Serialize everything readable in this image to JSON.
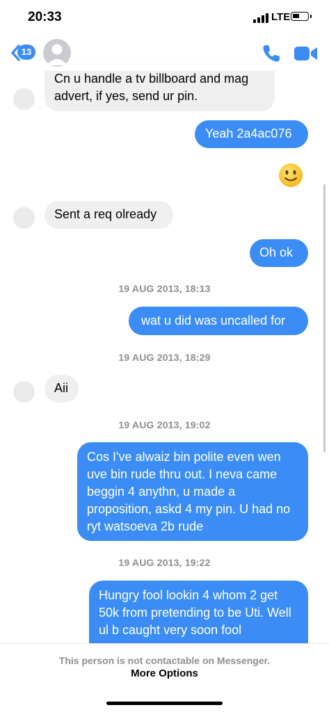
{
  "status_bar": {
    "time": "20:33",
    "carrier": "LTE"
  },
  "header": {
    "back_count": "13",
    "phone_icon": "phone-icon",
    "video_icon": "video-camera-icon"
  },
  "messages": [
    {
      "direction": "in",
      "text": "Cn u handle a tv billboard and mag advert, if yes, send ur pin."
    },
    {
      "direction": "out",
      "text": "Yeah 2a4ac076"
    },
    {
      "direction": "out",
      "emoji": "slightly-smiling-face"
    },
    {
      "direction": "in",
      "text": "Sent a req olready"
    },
    {
      "direction": "out",
      "text": "Oh ok"
    },
    {
      "timestamp": "19 AUG 2013, 18:13"
    },
    {
      "direction": "out",
      "text": "wat u did was uncalled for"
    },
    {
      "timestamp": "19 AUG 2013, 18:29"
    },
    {
      "direction": "in",
      "text": "Aii"
    },
    {
      "timestamp": "19 AUG 2013, 19:02"
    },
    {
      "direction": "out",
      "text": "Cos I've alwaiz bin polite even wen uve bin rude thru out. I neva came beggin 4 anythn, u made a proposition, askd 4 my pin. U had no ryt watsoeva 2b rude"
    },
    {
      "timestamp": "19 AUG 2013, 19:22"
    },
    {
      "direction": "out",
      "text": "Hungry fool lookin 4 whom 2 get 50k from pretending to be Uti. Well ul b caught very soon fool"
    }
  ],
  "footer": {
    "note": "This person is not contactable on Messenger.",
    "link": "More Options"
  },
  "colors": {
    "outgoing_bubble": "#3b8df5",
    "incoming_bubble": "#efefef",
    "accent": "#3b8df5",
    "timestamp": "#8e8e93"
  }
}
